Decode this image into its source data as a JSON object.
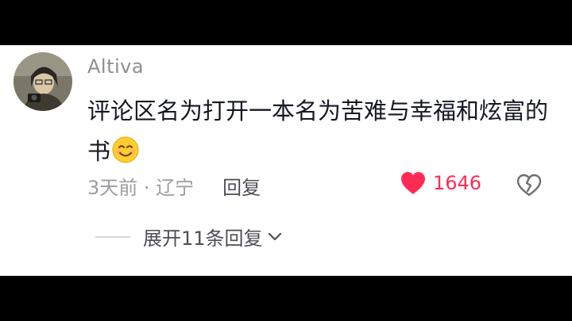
{
  "comment": {
    "username": "Altiva",
    "text": "评论区名为打开一本名为苦难与幸福和炫富的书",
    "emoji": "smiling-face-emoji",
    "time_location": "3天前 · 辽宁",
    "reply_label": "回复",
    "like_count": "1646",
    "expand_label": "展开11条回复"
  },
  "colors": {
    "like_red": "#fe2c55",
    "meta_gray": "#9c9ca2",
    "text_dark": "#161823"
  },
  "icons": {
    "like": "heart-icon",
    "dislike": "broken-heart-icon",
    "expand": "chevron-down-icon"
  }
}
